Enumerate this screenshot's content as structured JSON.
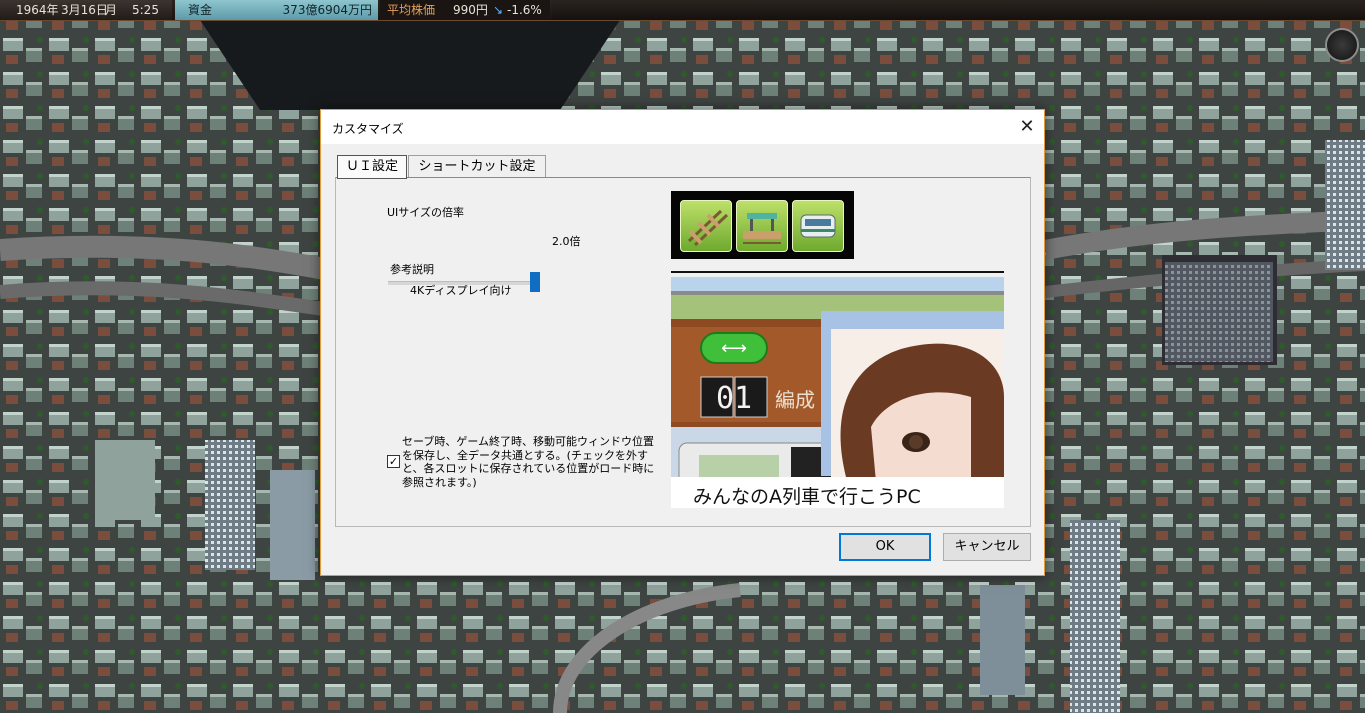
{
  "status_bar": {
    "year": "1964年",
    "date": "3月16日",
    "weekday": "月",
    "time": "5:25",
    "funds_label": "資金",
    "funds_value": "373億6904万円",
    "stock_label": "平均株価",
    "stock_value": "990円",
    "stock_change_arrow": "↘",
    "stock_change": "-1.6%",
    "accent_funds": "#7fbccb",
    "accent_stock_label": "#e3a05a",
    "accent_change": "#5db3ff"
  },
  "dialog": {
    "title": "カスタマイズ",
    "close_icon": "close-icon",
    "tabs": [
      {
        "label": "ＵＩ設定",
        "selected": true
      },
      {
        "label": "ショートカット設定",
        "selected": false
      }
    ],
    "ui_scale": {
      "label": "UIサイズの倍率",
      "value_text": "2.0倍",
      "level": 1.0
    },
    "reference": {
      "label": "参考説明",
      "text": "4Kディスプレイ向け"
    },
    "save_window_option": {
      "checked": true,
      "text": "セーブ時、ゲーム終了時、移動可能ウィンドウ位置を保存し、全データ共通とする。(チェックを外すと、各スロットに保存されている位置がロード時に参照されます。)"
    },
    "preview": {
      "icons": [
        "rail-track-icon",
        "station-icon",
        "train-icon"
      ],
      "badge_text": "01",
      "badge_label": "編成",
      "caption": "みんなのA列車で行こうPC"
    },
    "ok_label": "OK",
    "cancel_label": "キャンセル",
    "border_color": "#e39a3b",
    "ok_border_color": "#0078d7"
  }
}
